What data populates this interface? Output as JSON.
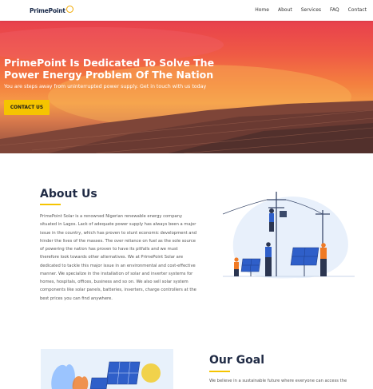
{
  "nav": {
    "logo_text": "PrimePoint",
    "links": [
      "Home",
      "About",
      "Services",
      "FAQ",
      "Contact"
    ]
  },
  "hero": {
    "title": "PrimePoint Is Dedicated To Solve The Power Energy Problem Of The Nation",
    "subtitle": "You are steps away from uninterrupted power supply. Get in touch with us today",
    "cta_label": "CONTACT US"
  },
  "about": {
    "title": "About Us",
    "paragraph": "PrimePoint Solar is a renowned Nigerian renewable energy company situated in Lagos. Lack of adequate power supply has always been a major issue in the country, which has proven to stunt economic development and hinder the lives of the masses. The over reliance on fuel as the sole source of powering the nation has proven to have its pitfalls and we must therefore look towards other alternatives. We at PrimePoint Solar are dedicated to tackle this major issue in an environmental and cost-effective manner. We specialize in the installation of solar and inverter systems for homes, hospitals, offices, business and so on. We also sell solar system components like solar panels, batteries, inverters, charge controllers at the best prices you can find anywhere."
  },
  "goal": {
    "title": "Our Goal",
    "paragraph": "We believe in a sustainable future where everyone can access the"
  },
  "colors": {
    "accent": "#f5c400",
    "heading": "#1f2a44",
    "worker": "#f07a24",
    "panel": "#2f5fc9"
  }
}
